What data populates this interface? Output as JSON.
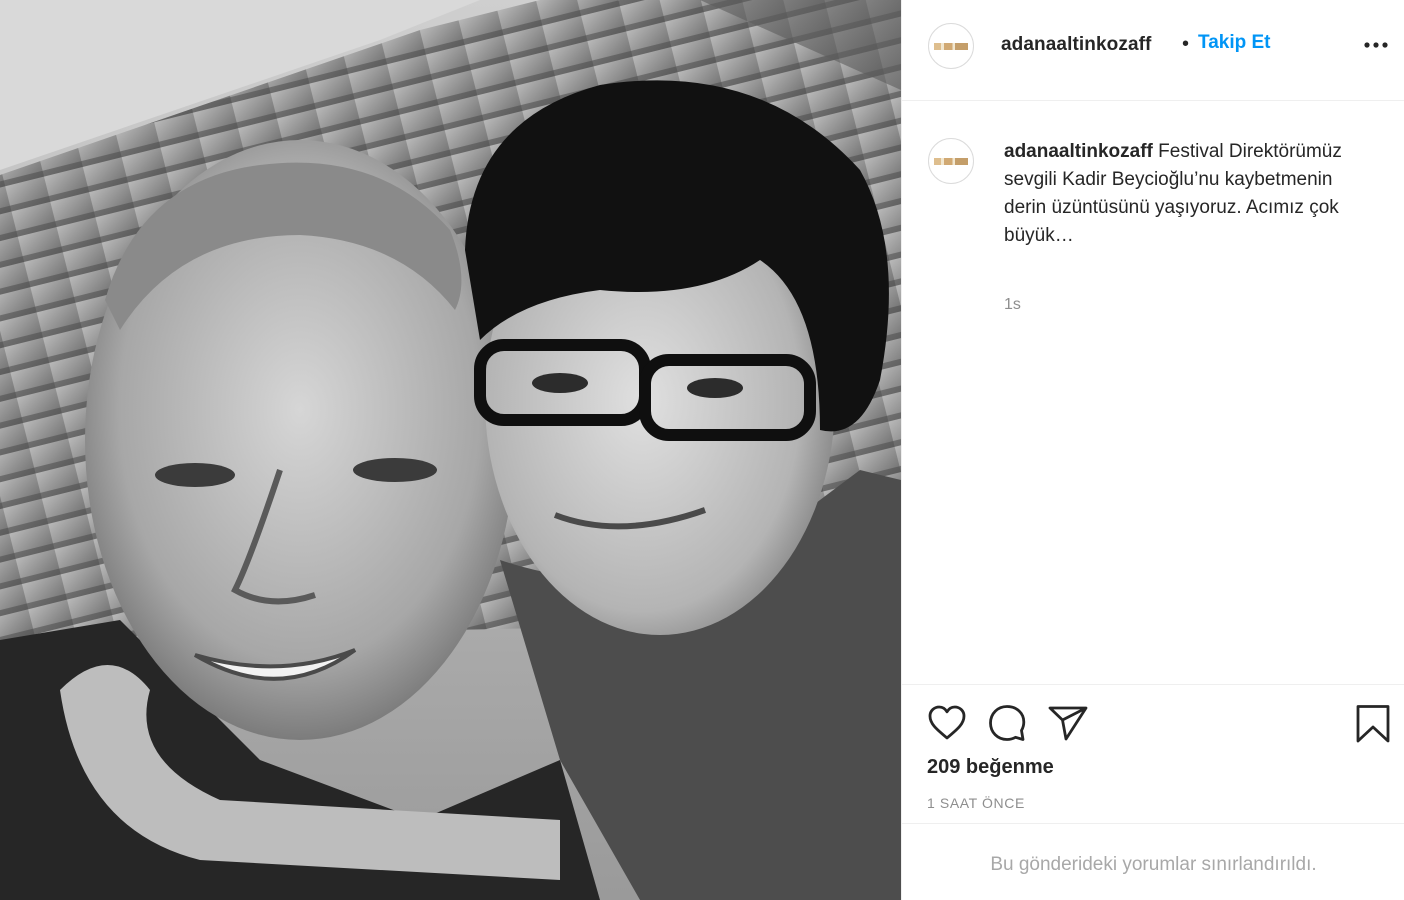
{
  "post": {
    "account": "adanaaltinkozaff",
    "separator": "•",
    "follow_label": "Takip Et",
    "more_label": "•••",
    "caption_user": "adanaaltinkozaff",
    "caption_text": "Festival Direktörümüz sevgili Kadir Beycioğlu’nu kaybetmenin derin üzüntüsünü yaşıyoruz. Acımız çok büyük…",
    "caption_time": "1s",
    "likes": "209 beğenme",
    "posted_ago": "1 SAAT ÖNCE",
    "comments_notice": "Bu gönderideki yorumlar sınırlandırıldı."
  },
  "icons": {
    "like": "heart-icon",
    "comment": "comment-icon",
    "share": "send-icon",
    "save": "bookmark-icon",
    "more": "more-options-icon"
  },
  "colors": {
    "link_blue": "#0095f6",
    "text_primary": "#262626",
    "text_muted": "#8e8e8e",
    "divider": "#efefef"
  }
}
